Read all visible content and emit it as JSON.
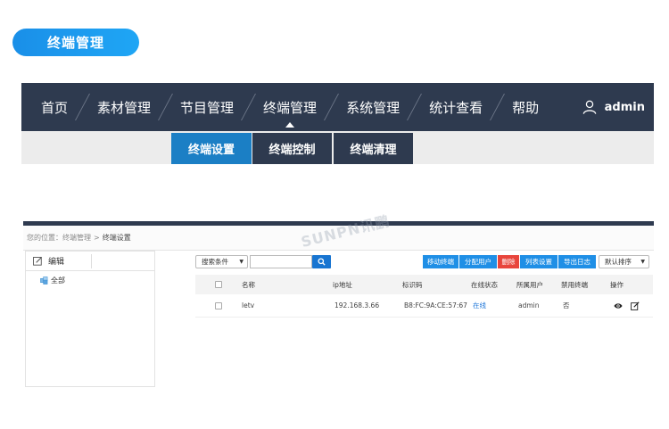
{
  "section_badge": "终端管理",
  "nav": {
    "items": [
      "首页",
      "素材管理",
      "节目管理",
      "终端管理",
      "系统管理",
      "统计查看",
      "帮助"
    ],
    "active_index": 3,
    "user": "admin"
  },
  "subnav": {
    "items": [
      "终端设置",
      "终端控制",
      "终端清理"
    ],
    "active_index": 0
  },
  "breadcrumb": {
    "prefix": "您的位置：",
    "parent": "终端管理",
    "separator": ">",
    "current": "终端设置"
  },
  "watermark": "SUNPN讯鹏",
  "tree": {
    "edit_label": "编辑",
    "root_label": "全部"
  },
  "toolbar": {
    "filter_select": "搜索条件",
    "search_value": "",
    "buttons": [
      "移动终端",
      "分配用户",
      "删除",
      "列表设置",
      "导出日志"
    ],
    "sort_select": "默认排序"
  },
  "table": {
    "headers": [
      "名称",
      "ip地址",
      "标识码",
      "在线状态",
      "所属用户",
      "禁用终端",
      "操作"
    ],
    "rows": [
      {
        "name": "letv",
        "ip": "192.168.3.66",
        "id_code": "B8:FC:9A:CE:57:67",
        "status": "在线",
        "user": "admin",
        "disabled": "否"
      }
    ]
  },
  "colors": {
    "nav_bg": "#2e3a4f",
    "accent": "#1b7fc5",
    "delete": "#e8453c",
    "button": "#1f8fe6"
  }
}
